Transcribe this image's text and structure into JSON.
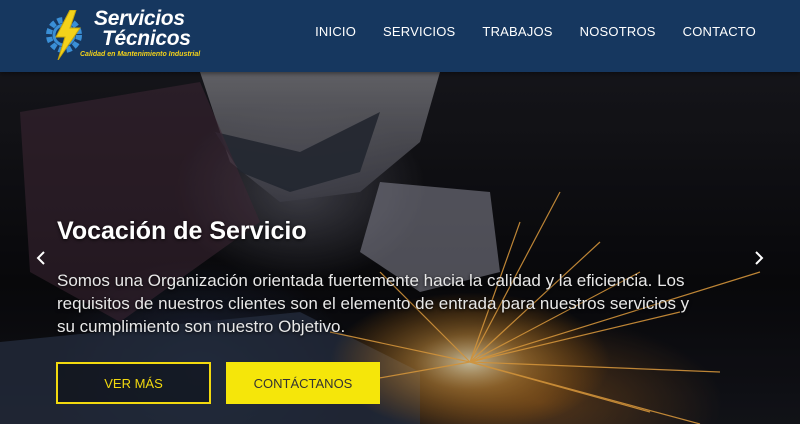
{
  "brand": {
    "line1": "Servicios",
    "line2": "Técnicos",
    "tagline": "Calidad en Mantenimiento Industrial"
  },
  "nav": {
    "items": [
      {
        "label": "INICIO"
      },
      {
        "label": "SERVICIOS"
      },
      {
        "label": "TRABAJOS"
      },
      {
        "label": "NOSOTROS"
      },
      {
        "label": "CONTACTO"
      }
    ]
  },
  "hero": {
    "title": "Vocación de Servicio",
    "description": "Somos una Organización orientada fuertemente hacia la calidad y la eficiencia. Los requisitos de nuestros clientes son el elemento de entrada para nuestros servicios y su cumplimiento son nuestro Objetivo.",
    "primary_button": "VER MÁS",
    "secondary_button": "CONTÁCTANOS",
    "prev_icon": "chevron-left-icon",
    "next_icon": "chevron-right-icon"
  },
  "colors": {
    "navbar": "#16375f",
    "accent_yellow": "#f5e60a",
    "gear_blue": "#3a8fd6"
  }
}
